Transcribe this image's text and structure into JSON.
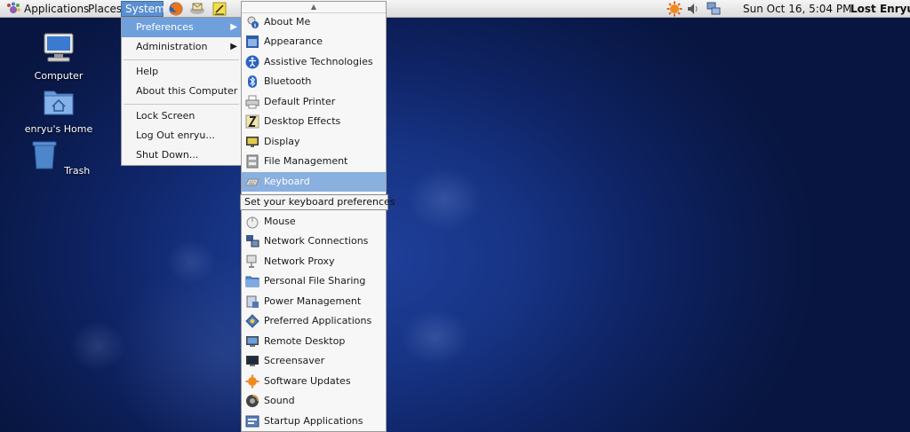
{
  "panel": {
    "menus": [
      "Applications",
      "Places",
      "System"
    ],
    "clock": "Sun Oct 16,  5:04 PM",
    "user": "Lost Enryu"
  },
  "desktop": {
    "icons": [
      {
        "label": "Computer",
        "icon": "computer-icon"
      },
      {
        "label": "enryu's Home",
        "icon": "home-folder-icon"
      },
      {
        "label": "Trash",
        "icon": "trash-icon"
      }
    ]
  },
  "system_menu": {
    "items": [
      "Preferences",
      "Administration",
      "Help",
      "About this Computer",
      "Lock Screen",
      "Log Out enryu...",
      "Shut Down..."
    ],
    "highlighted": "Preferences"
  },
  "preferences_menu": {
    "items": [
      "About Me",
      "Appearance",
      "Assistive Technologies",
      "Bluetooth",
      "Default Printer",
      "Desktop Effects",
      "Display",
      "File Management",
      "Keyboard",
      "Mouse",
      "Network Connections",
      "Network Proxy",
      "Personal File Sharing",
      "Power Management",
      "Preferred Applications",
      "Remote Desktop",
      "Screensaver",
      "Software Updates",
      "Sound",
      "Startup Applications"
    ],
    "highlighted": "Keyboard",
    "tooltip": "Set your keyboard preferences"
  },
  "colors": {
    "menu_highlight": "#6fa0dc",
    "desktop_bg": "#163383"
  }
}
